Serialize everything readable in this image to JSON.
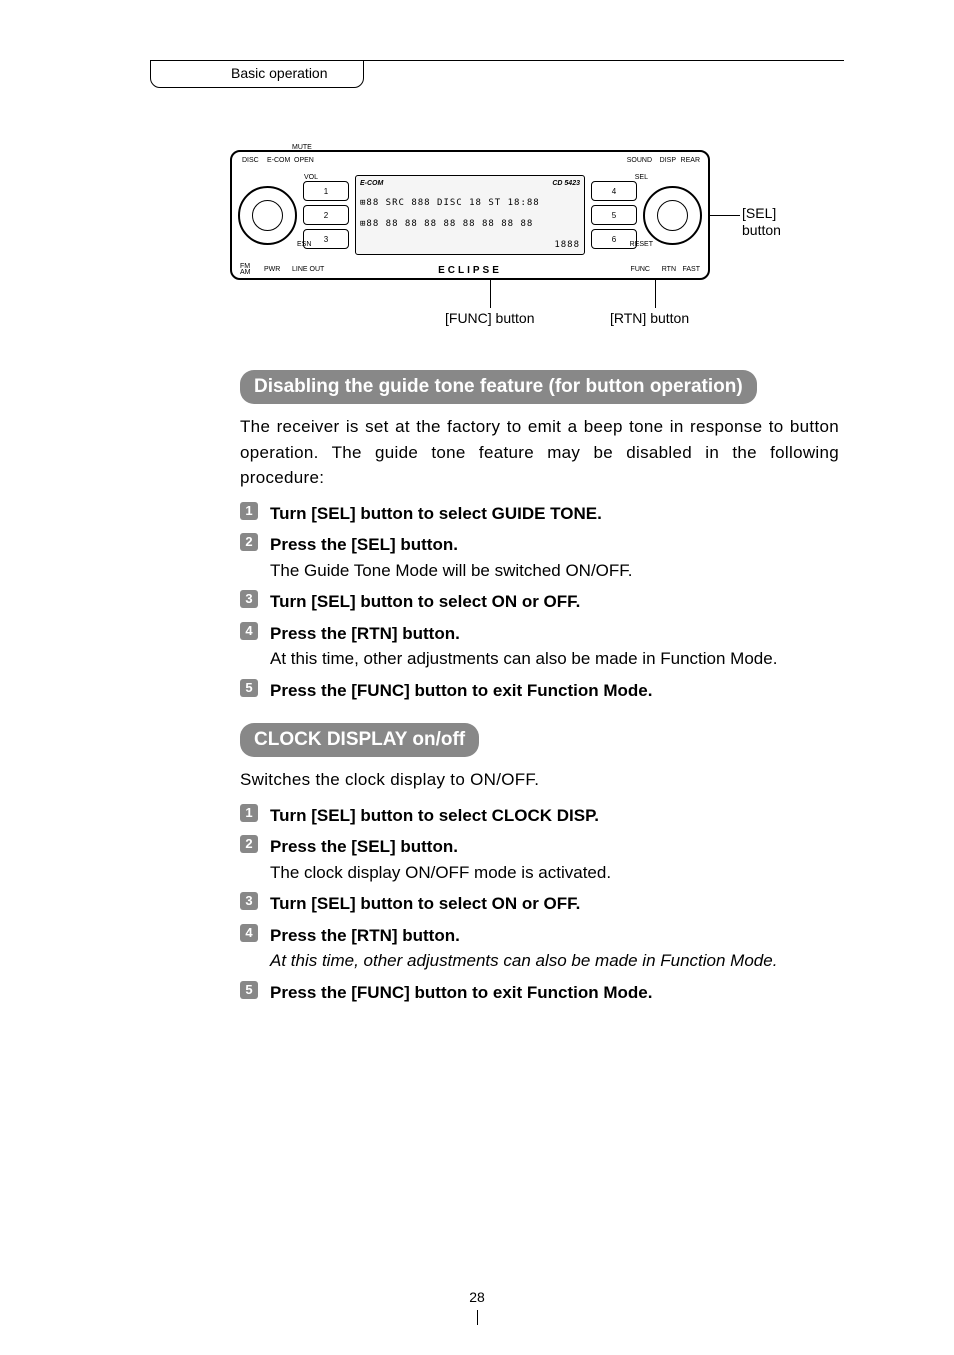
{
  "header": {
    "section": "Basic operation"
  },
  "device": {
    "brand_top": "E-COM",
    "model": "CD 5423",
    "brand": "ECLIPSE",
    "left_btns": [
      "1",
      "2",
      "3"
    ],
    "right_btns": [
      "4",
      "5",
      "6"
    ],
    "seg1": "⊞88  SRC 888 DISC 18 ST 18:88",
    "seg2": "⊞88  88 88 88 88 88 88 88 88",
    "seg3": "1888",
    "misc_labels": [
      "MUTE",
      "DISC",
      "E-COM",
      "OPEN",
      "VOL",
      "ESN",
      "FM",
      "AM",
      "PWR",
      "LINE OUT",
      "SOUND",
      "DISP",
      "REAR",
      "SEL",
      "RESET",
      "FUNC",
      "RTN",
      "FAST"
    ]
  },
  "callouts": {
    "sel": "[SEL]\nbutton",
    "func": "[FUNC] button",
    "rtn": "[RTN] button"
  },
  "sectionA": {
    "title": "Disabling the guide tone feature (for button operation)",
    "intro": "The receiver is set at the factory to emit a beep tone in response to button operation. The guide tone feature may be disabled in the following procedure:",
    "steps": [
      {
        "head": "Turn [SEL] button to select GUIDE TONE."
      },
      {
        "head": "Press the [SEL] button.",
        "body": "The Guide Tone Mode will be switched ON/OFF."
      },
      {
        "head": "Turn [SEL] button to select ON or OFF."
      },
      {
        "head": "Press the [RTN] button.",
        "body": "At this time, other adjustments can also be made in Function Mode."
      },
      {
        "head": "Press the [FUNC] button to exit Function Mode."
      }
    ]
  },
  "sectionB": {
    "title": "CLOCK DISPLAY on/off",
    "intro": "Switches the clock display to ON/OFF.",
    "steps": [
      {
        "head": "Turn [SEL] button to select CLOCK DISP."
      },
      {
        "head": "Press the [SEL] button.",
        "body": "The clock display ON/OFF mode is activated."
      },
      {
        "head": "Turn [SEL] button to select ON or OFF."
      },
      {
        "head": "Press the [RTN] button.",
        "body_italic": "At this time, other adjustments can also be made in Function Mode."
      },
      {
        "head": "Press the [FUNC] button to exit Function Mode."
      }
    ]
  },
  "page_number": "28"
}
